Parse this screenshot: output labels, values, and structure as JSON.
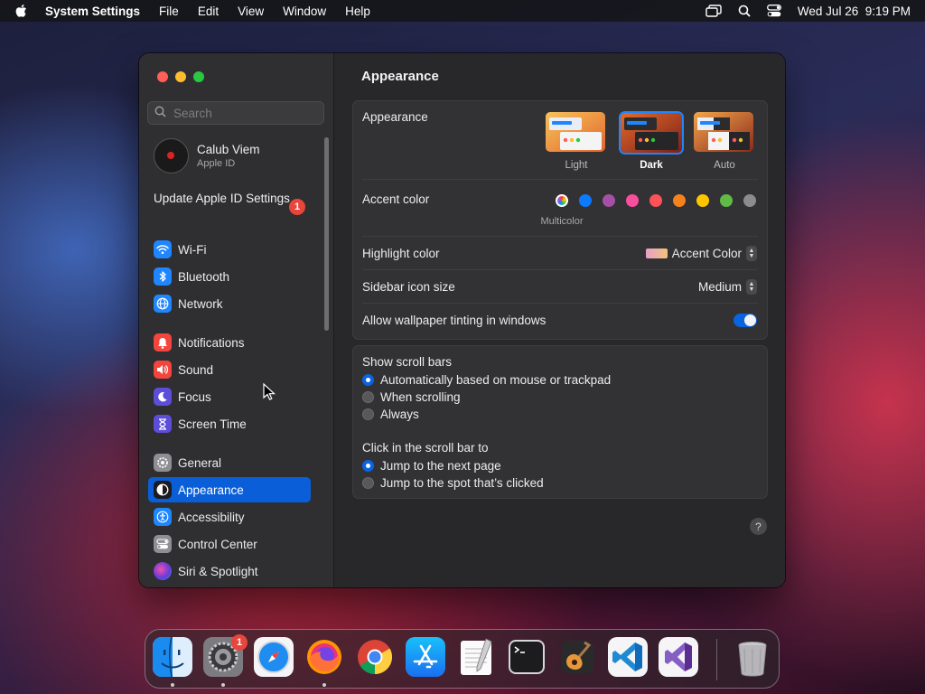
{
  "menubar": {
    "app_name": "System Settings",
    "items": [
      "File",
      "Edit",
      "View",
      "Window",
      "Help"
    ],
    "datetime": "Wed Jul 26  9:19 PM"
  },
  "sidebar": {
    "search_placeholder": "Search",
    "profile": {
      "name": "Calub Viem",
      "subtitle": "Apple ID"
    },
    "update": {
      "label": "Update Apple ID Settings",
      "badge": "1"
    },
    "groups": [
      [
        {
          "label": "Wi-Fi",
          "icon": "wifi-icon",
          "color": "#1f86ff"
        },
        {
          "label": "Bluetooth",
          "icon": "bluetooth-icon",
          "color": "#1f86ff"
        },
        {
          "label": "Network",
          "icon": "globe-icon",
          "color": "#1f86ff"
        }
      ],
      [
        {
          "label": "Notifications",
          "icon": "bell-icon",
          "color": "#f2453d"
        },
        {
          "label": "Sound",
          "icon": "speaker-icon",
          "color": "#f2453d"
        },
        {
          "label": "Focus",
          "icon": "moon-icon",
          "color": "#5d4ddb"
        },
        {
          "label": "Screen Time",
          "icon": "hourglass-icon",
          "color": "#5d4ddb"
        }
      ],
      [
        {
          "label": "General",
          "icon": "gear-icon",
          "color": "#8e8e93"
        },
        {
          "label": "Appearance",
          "icon": "appearance-icon",
          "color": "#1c1c1e",
          "selected": true
        },
        {
          "label": "Accessibility",
          "icon": "accessibility-icon",
          "color": "#1f86ff"
        },
        {
          "label": "Control Center",
          "icon": "control-center-icon",
          "color": "#8e8e93"
        },
        {
          "label": "Siri & Spotlight",
          "icon": "siri-icon",
          "color": "#b23ad8"
        }
      ]
    ]
  },
  "content": {
    "title": "Appearance",
    "appearance": {
      "label": "Appearance",
      "options": [
        {
          "label": "Light",
          "selected": false
        },
        {
          "label": "Dark",
          "selected": true
        },
        {
          "label": "Auto",
          "selected": false
        }
      ]
    },
    "accent": {
      "label": "Accent color",
      "selected_label": "Multicolor",
      "colors": [
        "multicolor",
        "#0a7aff",
        "#a550a7",
        "#f74f9e",
        "#ff5257",
        "#f7821b",
        "#ffc600",
        "#62ba46",
        "#8c8c8c"
      ]
    },
    "highlight": {
      "label": "Highlight color",
      "value": "Accent Color"
    },
    "sidebar_icon_size": {
      "label": "Sidebar icon size",
      "value": "Medium"
    },
    "wallpaper_tinting": {
      "label": "Allow wallpaper tinting in windows",
      "enabled": true
    },
    "scroll_bars": {
      "label": "Show scroll bars",
      "options": [
        {
          "label": "Automatically based on mouse or trackpad",
          "selected": true
        },
        {
          "label": "When scrolling",
          "selected": false
        },
        {
          "label": "Always",
          "selected": false
        }
      ]
    },
    "click_scroll": {
      "label": "Click in the scroll bar to",
      "options": [
        {
          "label": "Jump to the next page",
          "selected": true
        },
        {
          "label": "Jump to the spot that’s clicked",
          "selected": false
        }
      ]
    },
    "help_label": "?"
  },
  "dock": {
    "apps": [
      {
        "name": "Finder",
        "icon": "finder-icon",
        "running": true
      },
      {
        "name": "System Settings",
        "icon": "system-settings-icon",
        "running": true,
        "badge": "1"
      },
      {
        "name": "Safari",
        "icon": "safari-icon",
        "running": false
      },
      {
        "name": "Firefox",
        "icon": "firefox-icon",
        "running": true
      },
      {
        "name": "Chrome",
        "icon": "chrome-icon",
        "running": false
      },
      {
        "name": "App Store",
        "icon": "app-store-icon",
        "running": false
      },
      {
        "name": "TextEdit",
        "icon": "textedit-icon",
        "running": false
      },
      {
        "name": "Terminal",
        "icon": "terminal-icon",
        "running": false
      },
      {
        "name": "GarageBand",
        "icon": "garageband-icon",
        "running": false
      },
      {
        "name": "Visual Studio Code",
        "icon": "vscode-icon",
        "running": false
      },
      {
        "name": "Visual Studio",
        "icon": "visual-studio-icon",
        "running": false
      }
    ],
    "trash": {
      "name": "Trash",
      "icon": "trash-icon"
    }
  }
}
